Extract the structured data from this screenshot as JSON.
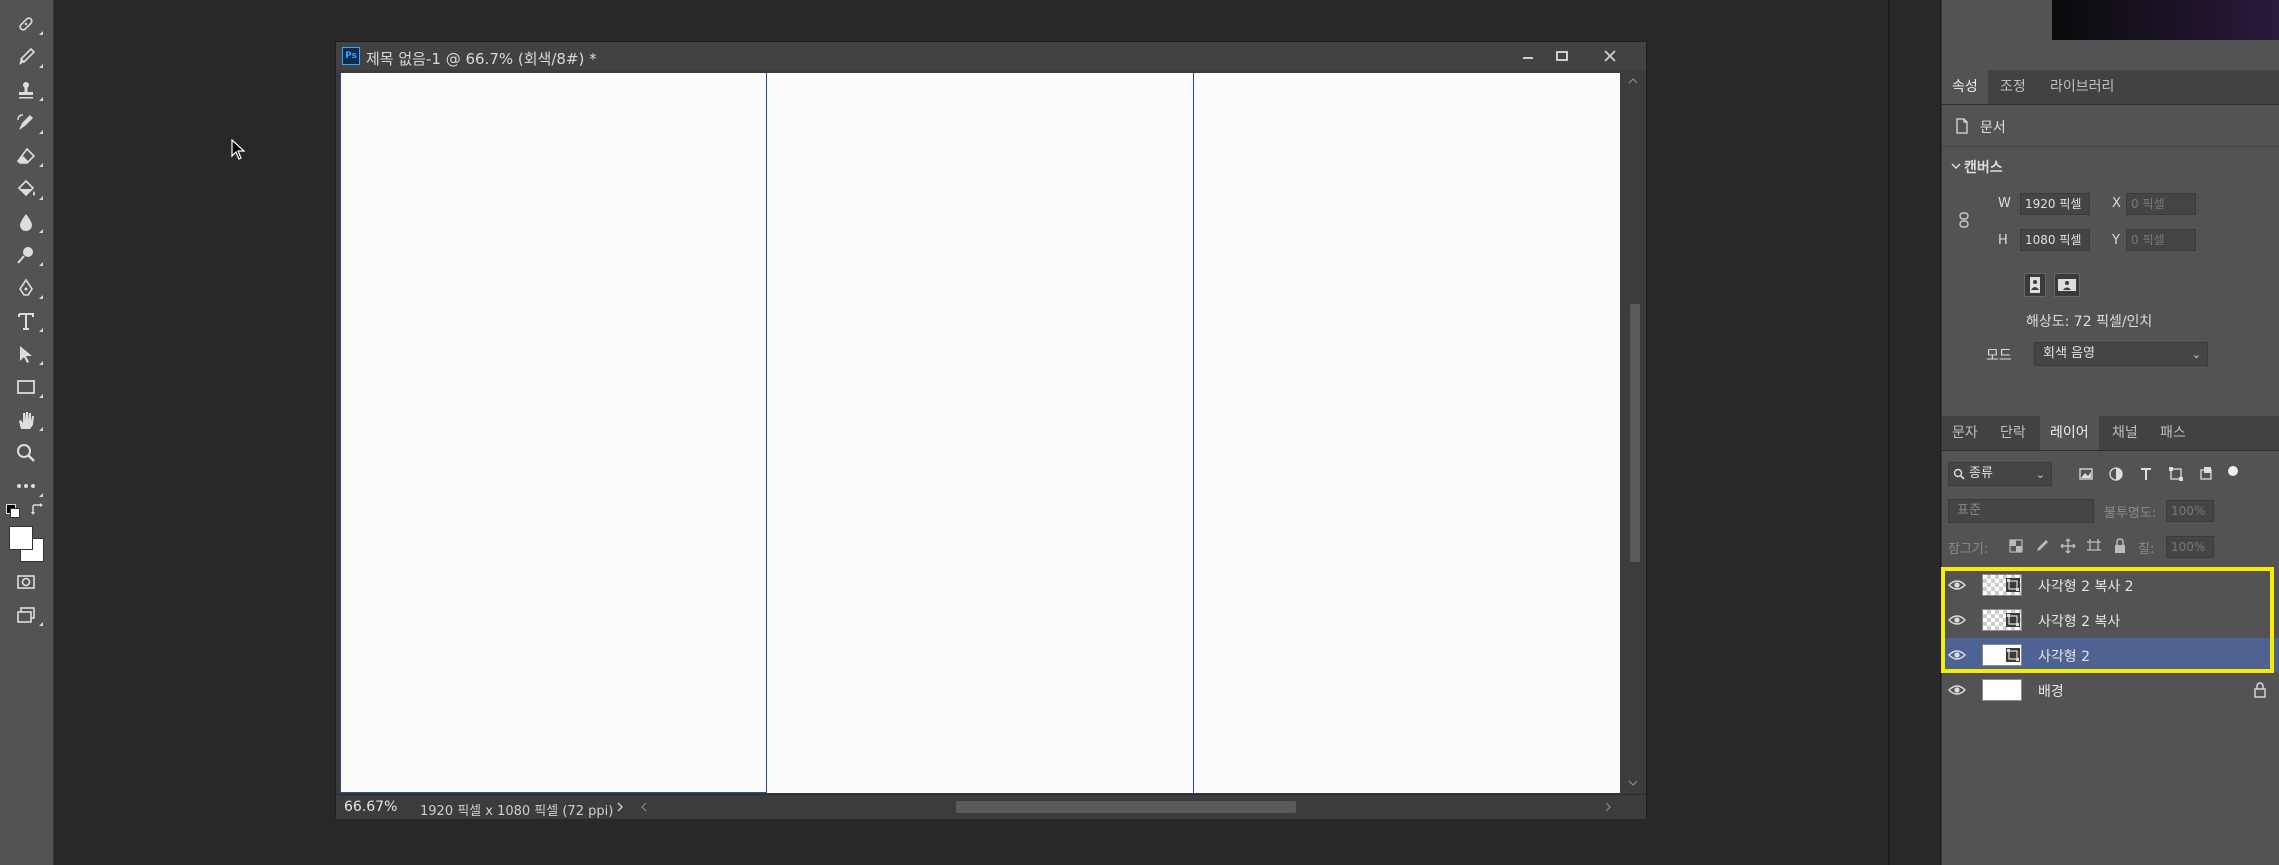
{
  "document": {
    "title": "제목 없음-1 @ 66.7% (회색/8#) *",
    "app_badge": "Ps",
    "zoom": "66.67%",
    "info": "1920 픽셀 x 1080 픽셀 (72 ppi)"
  },
  "properties": {
    "tabs": [
      "속성",
      "조정",
      "라이브러리"
    ],
    "doc_label": "문서",
    "canvas_section": "캔버스",
    "w_label": "W",
    "w_value": "1920 픽셀",
    "h_label": "H",
    "h_value": "1080 픽셀",
    "x_label": "X",
    "x_placeholder": "0 픽셀",
    "y_label": "Y",
    "y_placeholder": "0 픽셀",
    "resolution": "해상도: 72 픽셀/인치",
    "mode_label": "모드",
    "mode_value": "회색 음영"
  },
  "layers_panel": {
    "tabs": [
      "문자",
      "단락",
      "레이어",
      "채널",
      "패스"
    ],
    "filter_label": "종류",
    "blend_mode": "표준",
    "opacity_label": "불투명도:",
    "opacity_value": "100%",
    "lock_label": "잠그기:",
    "fill_label": "칠:",
    "fill_value": "100%",
    "layers": [
      {
        "name": "사각형 2 복사 2",
        "type": "shape",
        "selected": false
      },
      {
        "name": "사각형 2 복사",
        "type": "shape",
        "selected": false
      },
      {
        "name": "사각형 2",
        "type": "shape",
        "selected": true
      },
      {
        "name": "배경",
        "type": "background",
        "selected": false,
        "locked": true
      }
    ]
  },
  "colors": {
    "accent_selection": "#4f6294",
    "highlight": "#f5ee00",
    "guide_line": "#2a4a8a"
  }
}
